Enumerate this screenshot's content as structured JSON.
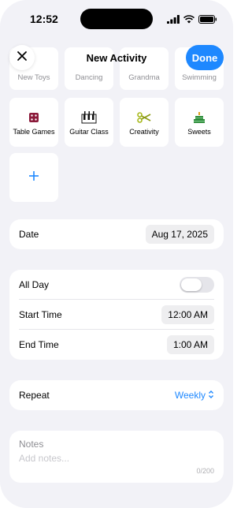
{
  "status_bar": {
    "time": "12:52"
  },
  "nav": {
    "title": "New Activity",
    "done_label": "Done"
  },
  "activities_top": [
    "New Toys",
    "Dancing",
    "Grandma",
    "Swimming"
  ],
  "activities": [
    {
      "label": "Table Games",
      "icon": "dice-icon"
    },
    {
      "label": "Guitar Class",
      "icon": "piano-keys-icon"
    },
    {
      "label": "Creativity",
      "icon": "scissors-icon"
    },
    {
      "label": "Sweets",
      "icon": "cake-icon"
    }
  ],
  "add_tile": {
    "icon": "plus-icon"
  },
  "date": {
    "label": "Date",
    "value": "Aug 17, 2025"
  },
  "time_card": {
    "all_day_label": "All Day",
    "all_day_on": false,
    "start_label": "Start Time",
    "start_value": "12:00 AM",
    "end_label": "End Time",
    "end_value": "1:00 AM"
  },
  "repeat": {
    "label": "Repeat",
    "value": "Weekly"
  },
  "notes": {
    "title": "Notes",
    "placeholder": "Add notes...",
    "counter": "0/200"
  },
  "colors": {
    "accent": "#1e88ff",
    "background": "#f2f2f7",
    "toggle_off": "#e5e5ea"
  }
}
